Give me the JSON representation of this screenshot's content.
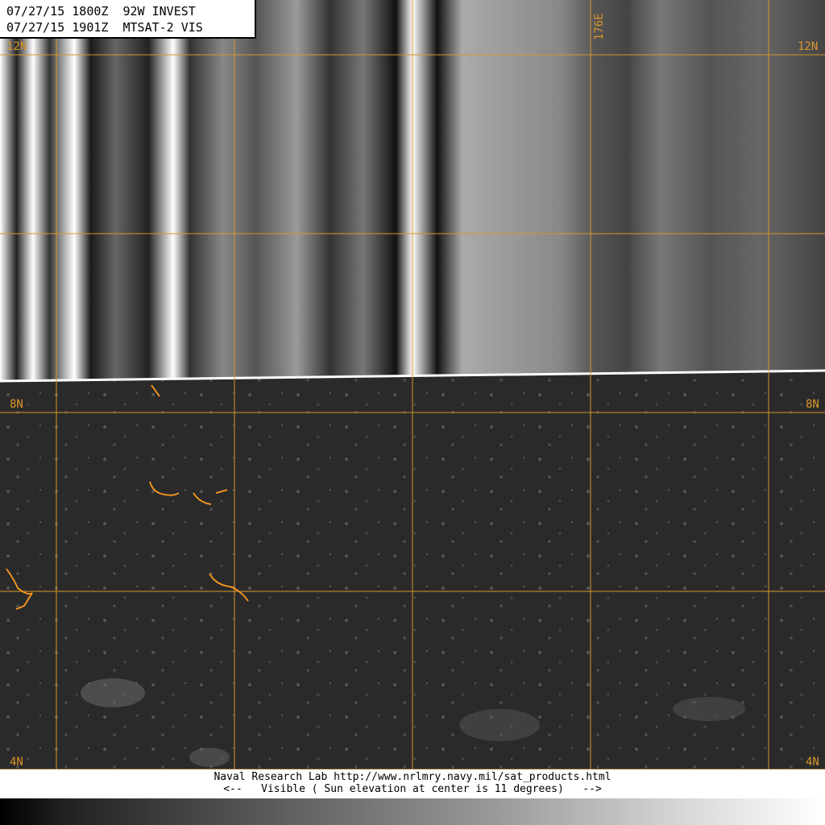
{
  "header": {
    "line1": "07/27/15 1800Z  92W INVEST",
    "line2": "07/27/15 1901Z  MTSAT-2 VIS"
  },
  "lat_labels": {
    "n12_left": "12N",
    "n12_right": "12N",
    "n8_left": "8N",
    "n8_right": "8N",
    "n4_left": "4N",
    "n4_right": "4N"
  },
  "lon_labels": {
    "e176": "176E"
  },
  "footer": {
    "line1": "Naval Research Lab http://www.nrlmry.navy.mil/sat_products.html",
    "line2": "<--   Visible ( Sun elevation at center is 11 degrees)   -->"
  },
  "colors": {
    "grid": "#d9962a",
    "coastline": "#ff9a1f",
    "background": "#000000"
  }
}
